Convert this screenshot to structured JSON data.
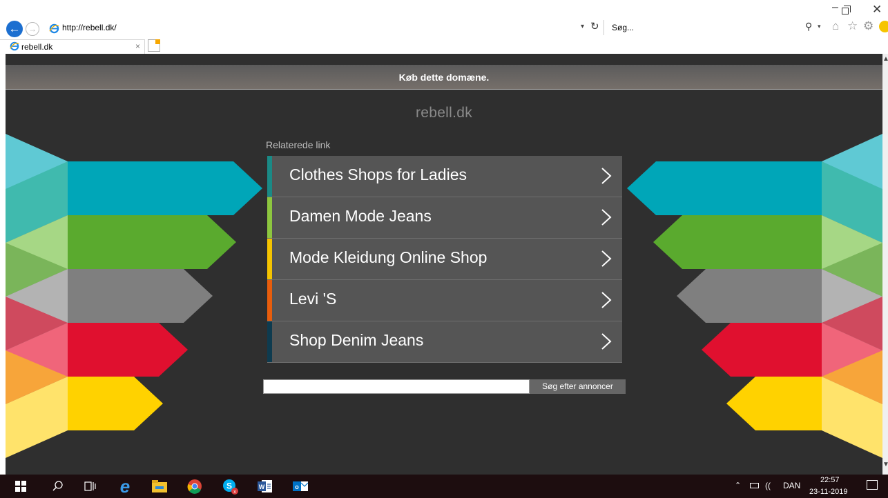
{
  "browser": {
    "url": "http://rebell.dk/",
    "search_placeholder": "Søg...",
    "tab_title": "rebell.dk",
    "icons": [
      "back-arrow-icon",
      "forward-arrow-icon",
      "ie-favicon-icon",
      "refresh-icon",
      "search-icon",
      "home-icon",
      "star-icon",
      "gear-icon",
      "smiley-icon",
      "minimize-icon",
      "restore-icon",
      "close-icon",
      "new-tab-icon"
    ]
  },
  "page": {
    "banner": "Køb dette domæne.",
    "domain": "rebell.dk",
    "related_label": "Relaterede link",
    "links": [
      {
        "label": "Clothes Shops for Ladies",
        "accent": "#1a8a86"
      },
      {
        "label": "Damen Mode Jeans",
        "accent": "#8dc63f"
      },
      {
        "label": "Mode Kleidung Online Shop",
        "accent": "#f5c400"
      },
      {
        "label": "Levi 'S",
        "accent": "#e85d0c"
      },
      {
        "label": "Shop Denim Jeans",
        "accent": "#0e3b4f"
      }
    ],
    "search_button": "Søg efter annoncer",
    "stripe_colors": [
      "#00a6b8",
      "#5aaa2e",
      "#7f7f7f",
      "#e0102f",
      "#ffd200"
    ]
  },
  "taskbar": {
    "icons": [
      "windows-start-icon",
      "search-icon",
      "task-view-icon",
      "edge-icon",
      "file-explorer-icon",
      "chrome-icon",
      "skype-icon",
      "word-icon",
      "outlook-icon"
    ],
    "language": "DAN",
    "time": "22:57",
    "date": "23-11-2019"
  }
}
